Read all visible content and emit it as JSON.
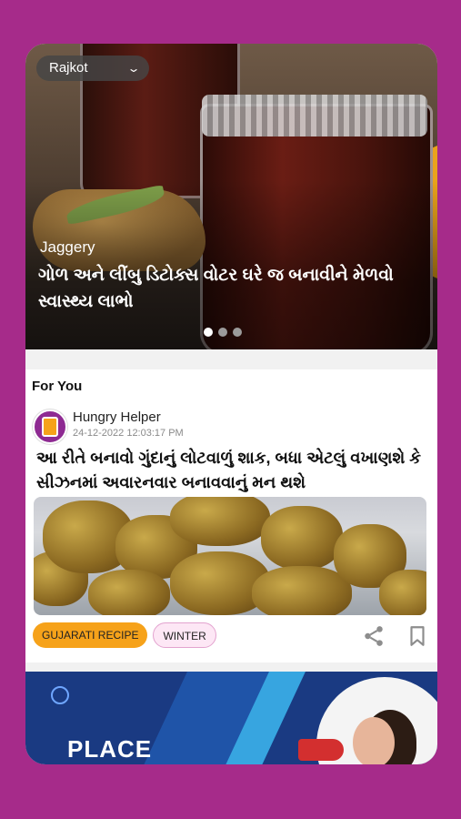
{
  "location": {
    "city": "Rajkot"
  },
  "hero": {
    "category": "Jaggery",
    "title": "ગોળ અને લીંબુ ડિટોક્સ વોટર ઘરે જ બનાવીને મેળવો સ્વાસ્થ્ય લાભો",
    "slide_count": 3,
    "active_slide": 1
  },
  "feed": {
    "section_title": "For You",
    "post": {
      "author": "Hungry Helper",
      "date": "24-12-2022  12:03:17 PM",
      "title": "આ રીતે બનાવો ગુંદાનું લોટવાળું શાક, બધા એટલું વખાણશે કે સીઝનમાં અવારનવાર બનાવવાનું મન થશે",
      "tags": [
        "GUJARATI RECIPE",
        "WINTER"
      ]
    }
  },
  "ad": {
    "text": "PLACE"
  },
  "colors": {
    "background": "#a62b8a",
    "tag_primary": "#f6a21a",
    "tag_secondary": "#fde7f5"
  },
  "icons": [
    "chevron-down-icon",
    "share-icon",
    "bookmark-icon"
  ]
}
